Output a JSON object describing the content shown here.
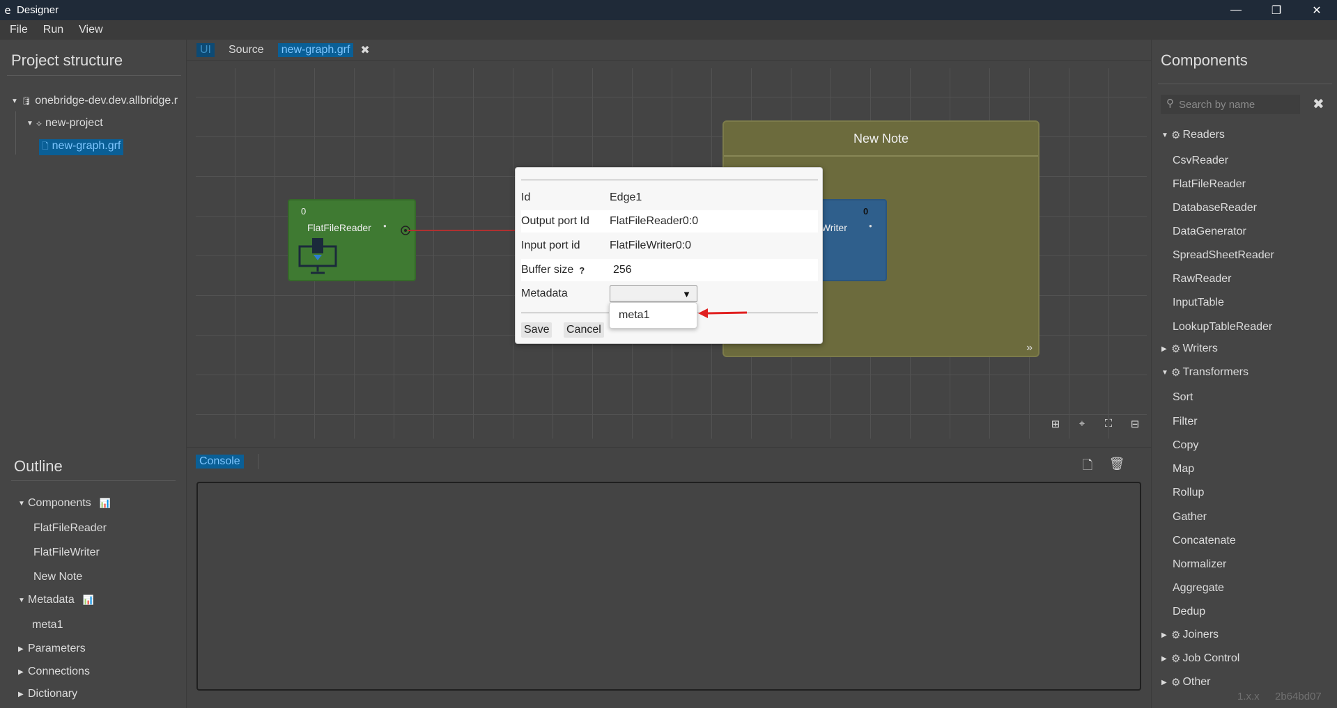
{
  "window": {
    "app_icon": "e",
    "title": "Designer",
    "minimize": "—",
    "maximize": "❐",
    "close": "✕"
  },
  "menu": [
    "File",
    "Run",
    "View"
  ],
  "project": {
    "title": "Project structure",
    "server": "onebridge-dev.dev.allbridge.r",
    "project_name": "new-project",
    "file": "new-graph.grf"
  },
  "outline": {
    "title": "Outline",
    "components_label": "Components",
    "components": [
      "FlatFileReader",
      "FlatFileWriter",
      "New Note"
    ],
    "metadata_label": "Metadata",
    "metadata": [
      "meta1"
    ],
    "parameters_label": "Parameters",
    "connections_label": "Connections",
    "dictionary_label": "Dictionary"
  },
  "editor_tabs": {
    "ui": "UI",
    "source": "Source",
    "file": "new-graph.grf",
    "close": "✖"
  },
  "graph": {
    "reader": {
      "count": "0",
      "name": "FlatFileReader"
    },
    "writer": {
      "count": "0",
      "name_partial": "eWriter"
    },
    "note": {
      "title": "New Note",
      "expand": "»"
    },
    "zoom_icons": [
      "⊞",
      "⌖",
      "⛶",
      "⊟"
    ]
  },
  "console": {
    "tab": "Console",
    "new_icon": "🗋",
    "delete_icon": "🗑"
  },
  "components_panel": {
    "title": "Components",
    "search_placeholder": "Search by name",
    "clear": "✖",
    "readers_label": "Readers",
    "readers": [
      "CsvReader",
      "FlatFileReader",
      "DatabaseReader",
      "DataGenerator",
      "SpreadSheetReader",
      "RawReader",
      "InputTable",
      "LookupTableReader"
    ],
    "writers_label": "Writers",
    "transformers_label": "Transformers",
    "transformers": [
      "Sort",
      "Filter",
      "Copy",
      "Map",
      "Rollup",
      "Gather",
      "Concatenate",
      "Normalizer",
      "Aggregate",
      "Dedup"
    ],
    "joiners_label": "Joiners",
    "job_control_label": "Job Control",
    "other_label": "Other"
  },
  "version": {
    "version": "1.x.x",
    "build": "2b64bd07"
  },
  "edge_dialog": {
    "id_label": "Id",
    "id_value": "Edge1",
    "output_label": "Output port Id",
    "output_value": "FlatFileReader0:0",
    "input_label": "Input port id",
    "input_value": "FlatFileWriter0:0",
    "buffer_label": "Buffer size",
    "buffer_help": "?",
    "buffer_value": "256",
    "metadata_label": "Metadata",
    "metadata_selected": "",
    "metadata_options": [
      "meta1"
    ],
    "save": "Save",
    "cancel": "Cancel"
  },
  "colors": {
    "accent": "#0a5f96",
    "reader": "#3f7a32",
    "writer": "#2f5f8c",
    "note": "#6c6b3d",
    "edge": "#b03030"
  }
}
